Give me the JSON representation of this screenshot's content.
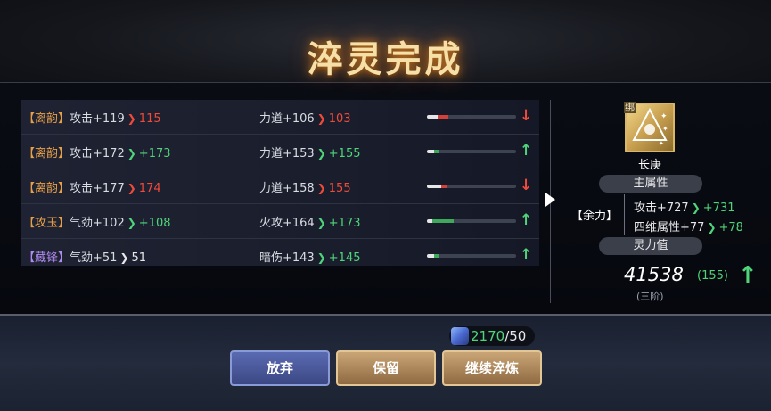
{
  "title": "淬灵完成",
  "rows": [
    {
      "tag": "【离韵】",
      "tag_color": "orange",
      "stat1": "攻击+119",
      "arrow1": "down",
      "new1": "115",
      "stat2": "力道+106",
      "arrow2": "down",
      "new2": "103",
      "progress_white": 0.12,
      "progress_color": 0.12,
      "progress_color_hex": "#d2423a",
      "indicator": "↓",
      "indicator_color": "red"
    },
    {
      "tag": "【离韵】",
      "tag_color": "orange",
      "stat1": "攻击+172",
      "arrow1": "up",
      "new1": "+173",
      "stat2": "力道+153",
      "arrow2": "up",
      "new2": "+155",
      "progress_white": 0.08,
      "progress_color": 0.06,
      "progress_color_hex": "#3fa85a",
      "indicator": "↑",
      "indicator_color": "green"
    },
    {
      "tag": "【离韵】",
      "tag_color": "orange",
      "stat1": "攻击+177",
      "arrow1": "down",
      "new1": "174",
      "stat2": "力道+158",
      "arrow2": "down",
      "new2": "155",
      "progress_white": 0.16,
      "progress_color": 0.06,
      "progress_color_hex": "#d2423a",
      "indicator": "↓",
      "indicator_color": "red"
    },
    {
      "tag": "【攻玉】",
      "tag_color": "orange",
      "stat1": "气劲+102",
      "arrow1": "up",
      "new1": "+108",
      "stat2": "火攻+164",
      "arrow2": "up",
      "new2": "+173",
      "progress_white": 0.06,
      "progress_color": 0.24,
      "progress_color_hex": "#3fa85a",
      "indicator": "↑",
      "indicator_color": "green"
    },
    {
      "tag": "【藏锋】",
      "tag_color": "purple",
      "stat1": "气劲+51",
      "arrow1": "same",
      "new1": "51",
      "stat2": "暗伤+143",
      "arrow2": "up",
      "new2": "+145",
      "progress_white": 0.08,
      "progress_color": 0.06,
      "progress_color_hex": "#3fa85a",
      "indicator": "↑",
      "indicator_color": "green"
    }
  ],
  "item": {
    "bind_tag": "绑",
    "name": "长庚",
    "main_attr_label": "主属性",
    "set_label": "【余力】",
    "attrs": [
      {
        "base": "攻击+727",
        "new": "+731"
      },
      {
        "base": "四维属性+77",
        "new": "+78"
      }
    ],
    "power_label": "灵力值",
    "power_value": "41538",
    "power_delta": "(155)",
    "power_arrow": "↑",
    "tier": "(三阶)"
  },
  "cost": {
    "have": "2170",
    "need": "/50",
    "icon": "crystal-icon"
  },
  "buttons": {
    "discard": "放弃",
    "keep": "保留",
    "continue": "继续淬炼"
  },
  "colors": {
    "up": "#4fd47a",
    "down": "#ef4a3a",
    "tag_orange": "#e8a048",
    "tag_purple": "#b08cf0",
    "title_glow": "#c87a22"
  }
}
